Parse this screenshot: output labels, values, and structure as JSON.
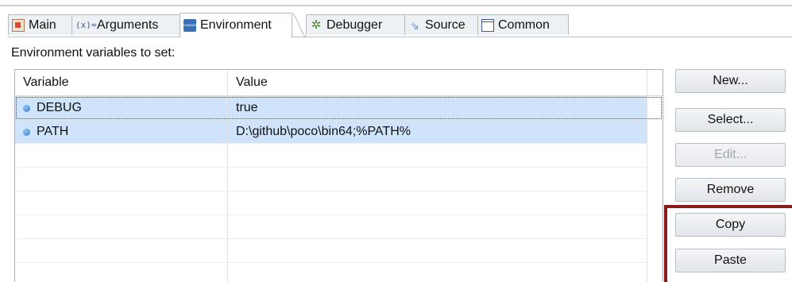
{
  "tabs": [
    {
      "label": "Main",
      "icon": "main-tab-icon"
    },
    {
      "label": "Arguments",
      "icon": "arguments-icon",
      "icon_glyph": "(x)="
    },
    {
      "label": "Environment",
      "icon": "environment-icon"
    },
    {
      "label": "Debugger",
      "icon": "debugger-icon",
      "icon_glyph": "✲"
    },
    {
      "label": "Source",
      "icon": "source-icon",
      "icon_glyph": "⇘"
    },
    {
      "label": "Common",
      "icon": "common-icon"
    }
  ],
  "active_tab": "Environment",
  "section_label": "Environment variables to set:",
  "table": {
    "columns": [
      "Variable",
      "Value"
    ],
    "rows": [
      {
        "variable": "DEBUG",
        "value": "true"
      },
      {
        "variable": "PATH",
        "value": "D:\\github\\poco\\bin64;%PATH%"
      }
    ]
  },
  "buttons": {
    "new": "New...",
    "select": "Select...",
    "edit": "Edit...",
    "remove": "Remove",
    "copy": "Copy",
    "paste": "Paste"
  },
  "colors": {
    "selection": "#cfe4fb",
    "highlight_box": "#8b1a1a"
  }
}
